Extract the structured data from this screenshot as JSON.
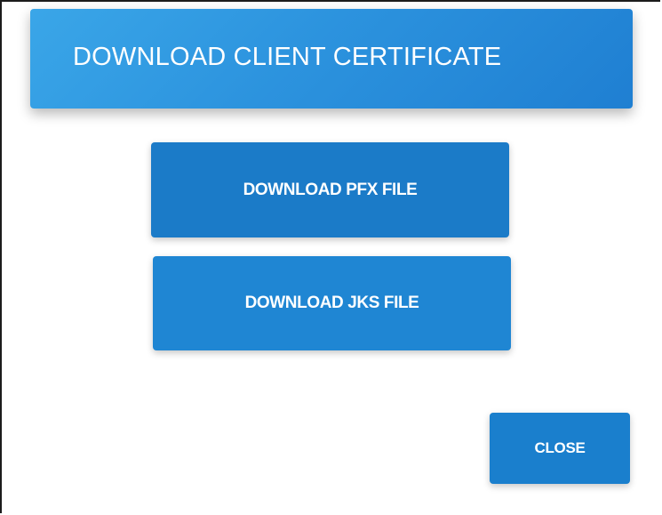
{
  "dialog": {
    "title": "DOWNLOAD CLIENT CERTIFICATE",
    "actions": {
      "download_pfx_label": "DOWNLOAD PFX FILE",
      "download_jks_label": "DOWNLOAD JKS FILE"
    },
    "footer": {
      "close_label": "CLOSE"
    }
  },
  "colors": {
    "header_gradient_start": "#3aa6e8",
    "header_gradient_end": "#1f7fd2",
    "primary_button": "#1b7bc8",
    "text_on_primary": "#ffffff"
  }
}
